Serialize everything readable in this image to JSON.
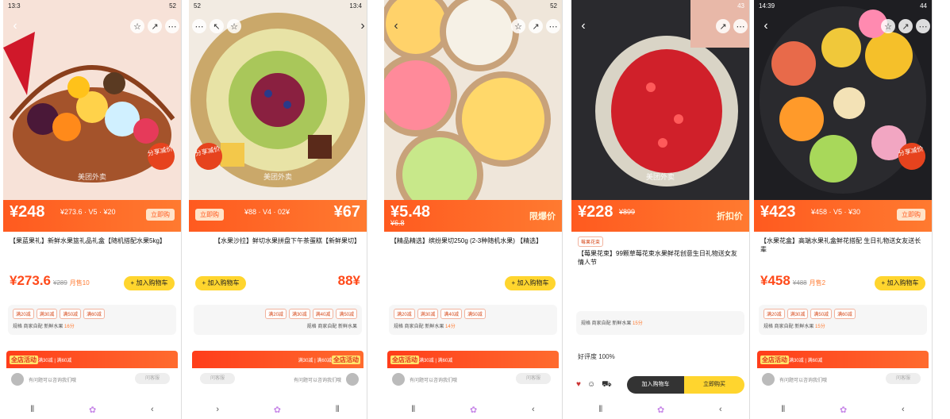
{
  "panels": [
    {
      "status_time": "13:3",
      "status_right": "52",
      "price_band": {
        "big": "¥248",
        "small": "¥273.6 · V5 · ¥20",
        "tag": "立即购"
      },
      "title": "【果蓝果礼】新鲜水果篮礼品礼盒【随机搭配水果5kg】",
      "price": "¥273.6",
      "orig": "¥289",
      "sold": "月售10",
      "add_label": "+ 加入购物车",
      "chips": [
        "满20减",
        "满30减",
        "满50减",
        "满60减"
      ],
      "spec_note": "规格 商家自配 新鲜水果",
      "spec_hl": "16分",
      "activity_label": "全店活动",
      "activity_text": "满30减 | 满60减",
      "service_text": "有问题可以咨询我们哦",
      "service_btn": "问客服",
      "watermark": "美团外卖",
      "badge": "分享减价"
    },
    {
      "status_time": "13:4",
      "status_right": "52",
      "price_band": {
        "big": "¥67",
        "small": "¥88 · V4 · 02¥",
        "tag": "立即购"
      },
      "title": "【水果沙拉】鲜切水果拼盘下午茶蛋糕【新鲜果切】",
      "price": "88¥",
      "orig": "",
      "sold": "",
      "add_label": "+ 加入购物车",
      "chips": [
        "满20减",
        "满30减",
        "满40减",
        "满50减"
      ],
      "spec_note": "规格 商家自配 新鲜水果",
      "spec_hl": "",
      "activity_label": "全店活动",
      "activity_text": "满30减 | 满60减",
      "service_text": "有问题可以咨询我们哦",
      "service_btn": "问客服",
      "watermark": "美团外卖",
      "badge": "分享减价"
    },
    {
      "status_time": "",
      "status_right": "52",
      "price_band": {
        "big": "¥5.48",
        "small": "¥6.8",
        "deal": "限爆价"
      },
      "title": "【精品精选】缤纷果切250g (2-3种随机水果) 【精选】",
      "price": "",
      "orig": "",
      "sold": "",
      "add_label": "+ 加入购物车",
      "chips": [
        "满20减",
        "满30减",
        "满40减",
        "满50减"
      ],
      "spec_note": "规格 商家自配 新鲜水果",
      "spec_hl": "14分",
      "activity_label": "全店活动",
      "activity_text": "满30减 | 满60减",
      "service_text": "有问题可以咨询我们哦",
      "service_btn": "问客服",
      "watermark": "",
      "badge": ""
    },
    {
      "status_time": "",
      "status_right": "43",
      "price_band": {
        "big": "¥228",
        "small": "¥899",
        "deal": "折扣价"
      },
      "title": "【莓果花束】99颗草莓花束水果鲜花创意生日礼物送女友情人节",
      "price": "",
      "orig": "",
      "sold": "",
      "add_label": "",
      "chips": [
        "莓果花束"
      ],
      "spec_note": "规格 商家自配 新鲜水果",
      "spec_hl": "15分",
      "activity_label": "",
      "activity_text": "好评度 100%",
      "service_text": "",
      "service_btn": "",
      "watermark": "美团外卖",
      "badge": "",
      "buy_dark": "加入购物车",
      "buy_yellow": "立即购买"
    },
    {
      "status_time": "14:39",
      "status_right": "44",
      "price_band": {
        "big": "¥423",
        "small": "¥458 · V5 · ¥30",
        "tag": "立即购"
      },
      "title": "【水果花盒】高端水果礼盒鲜花搭配 生日礼物送女友送长辈",
      "price": "¥458",
      "orig": "¥488",
      "sold": "月售2",
      "add_label": "+ 加入购物车",
      "chips": [
        "满20减",
        "满30减",
        "满50减",
        "满60减"
      ],
      "spec_note": "规格 商家自配 新鲜水果",
      "spec_hl": "15分",
      "activity_label": "全店活动",
      "activity_text": "满30减 | 满60减",
      "service_text": "有问题可以咨询我们哦",
      "service_btn": "问客服",
      "watermark": "",
      "badge": "分享减价"
    }
  ],
  "colors": {
    "brand_orange": "#ff5a1f",
    "add_yellow": "#ffd52e",
    "activity_red": "#ff3d1a"
  },
  "icons": [
    "back-icon",
    "share-icon",
    "more-icon",
    "favorite-icon",
    "cart-icon",
    "home-nav-icon",
    "menu-nav-icon",
    "back-nav-icon"
  ]
}
